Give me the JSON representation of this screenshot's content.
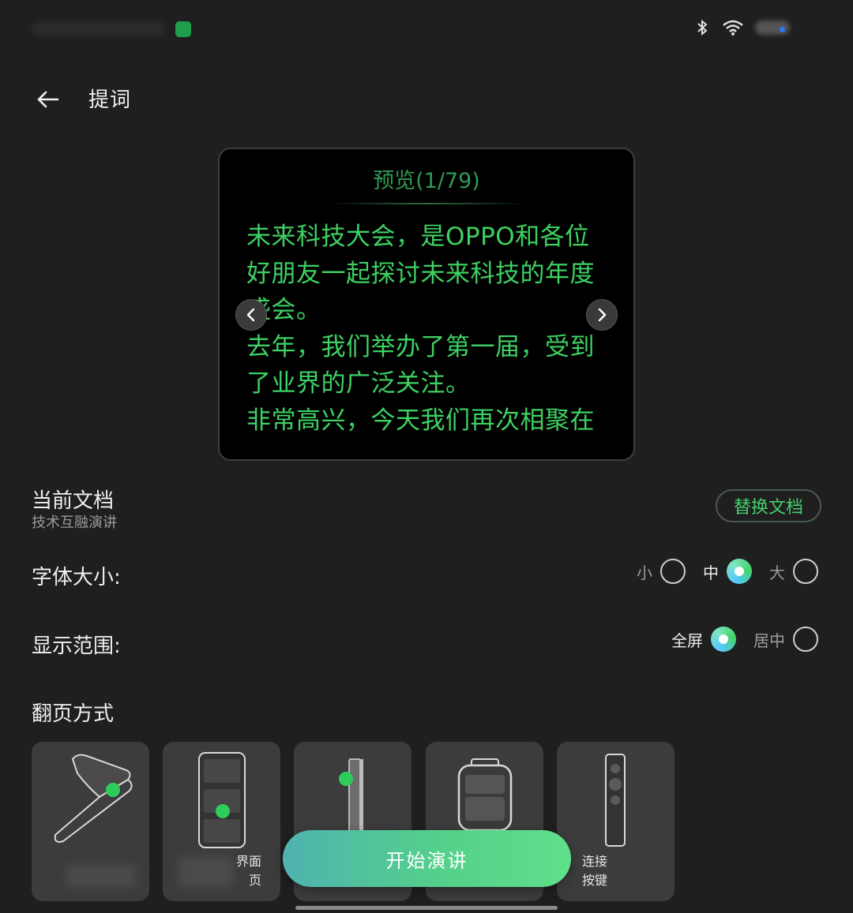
{
  "status_bar": {
    "icons": [
      "bluetooth-icon",
      "wifi-icon",
      "battery-icon"
    ]
  },
  "header": {
    "title": "提词",
    "back_icon": "arrow-left-icon"
  },
  "preview": {
    "title": "预览(1/79)",
    "text": "未来科技大会，是OPPO和各位\n好朋友一起探讨未来科技的年度\n盛会。\n去年，我们举办了第一届，受到\n了业界的广泛关注。\n非常高兴，今天我们再次相聚在",
    "prev_icon": "chevron-left-icon",
    "next_icon": "chevron-right-icon",
    "text_color": "#3ed163"
  },
  "current_doc": {
    "label": "当前文档",
    "name": "技术互融演讲",
    "replace_label": "替换文档"
  },
  "font_size": {
    "label": "字体大小:",
    "options": [
      {
        "label": "小",
        "selected": false
      },
      {
        "label": "中",
        "selected": true
      },
      {
        "label": "大",
        "selected": false
      }
    ]
  },
  "display_range": {
    "label": "显示范围:",
    "options": [
      {
        "label": "全屏",
        "selected": true
      },
      {
        "label": "居中",
        "selected": false
      }
    ]
  },
  "page_turn": {
    "label": "翻页方式",
    "cards": [
      {
        "label": "",
        "icon": "flip-phone-icon"
      },
      {
        "label": "界面\n页",
        "icon": "phone-screen-icon"
      },
      {
        "label": "",
        "icon": "side-button-icon"
      },
      {
        "label": "",
        "icon": "smartwatch-icon"
      },
      {
        "label": "连接\n按键",
        "icon": "remote-clicker-icon"
      }
    ]
  },
  "start_button": {
    "label": "开始演讲"
  },
  "colors": {
    "accent": "#47d06c",
    "background": "#1f1f1f",
    "preview_bg": "#000000"
  }
}
